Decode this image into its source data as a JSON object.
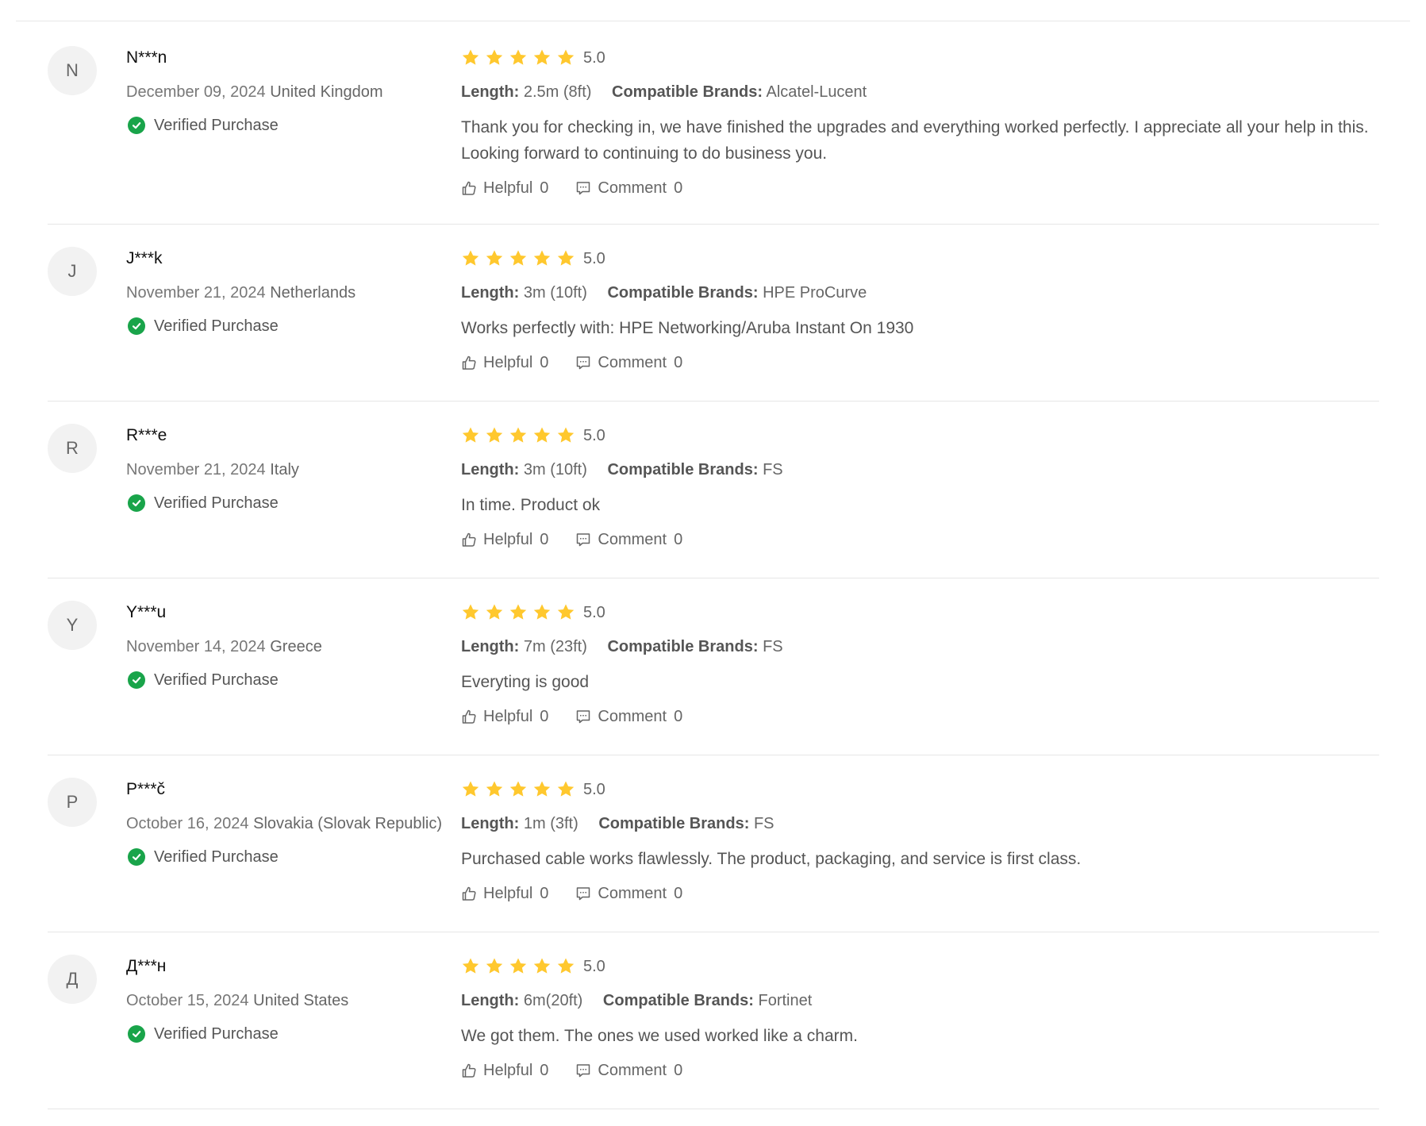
{
  "colors": {
    "star": "#FFC82E",
    "verified": "#19A44A",
    "divider": "#E6E6E6"
  },
  "labels": {
    "verified": "Verified Purchase",
    "length": "Length:",
    "brands": "Compatible Brands:",
    "helpful": "Helpful",
    "comment": "Comment"
  },
  "reviews": [
    {
      "initial": "N",
      "name": "N***n",
      "date": "December 09, 2024",
      "country": "United Kingdom",
      "rating": "5.0",
      "stars": 5,
      "length": "2.5m (8ft)",
      "brands": "Alcatel-Lucent",
      "text": "Thank you for checking in, we have finished the upgrades and everything worked perfectly. I appreciate all your help in this. Looking forward to continuing to do business you.",
      "helpful": "0",
      "comments": "0"
    },
    {
      "initial": "J",
      "name": "J***k",
      "date": "November 21, 2024",
      "country": "Netherlands",
      "rating": "5.0",
      "stars": 5,
      "length": "3m (10ft)",
      "brands": "HPE ProCurve",
      "text": "Works perfectly with: HPE Networking/Aruba Instant On 1930",
      "helpful": "0",
      "comments": "0"
    },
    {
      "initial": "R",
      "name": "R***e",
      "date": "November 21, 2024",
      "country": "Italy",
      "rating": "5.0",
      "stars": 5,
      "length": "3m (10ft)",
      "brands": "FS",
      "text": "In time. Product ok",
      "helpful": "0",
      "comments": "0"
    },
    {
      "initial": "Y",
      "name": "Y***u",
      "date": "November 14, 2024",
      "country": "Greece",
      "rating": "5.0",
      "stars": 5,
      "length": "7m (23ft)",
      "brands": "FS",
      "text": "Everyting is good",
      "helpful": "0",
      "comments": "0"
    },
    {
      "initial": "P",
      "name": "P***č",
      "date": "October 16, 2024",
      "country": "Slovakia (Slovak Republic)",
      "rating": "5.0",
      "stars": 5,
      "length": "1m (3ft)",
      "brands": "FS",
      "text": "Purchased cable works flawlessly. The product, packaging, and service is first class.",
      "helpful": "0",
      "comments": "0"
    },
    {
      "initial": "Д",
      "name": "Д***н",
      "date": "October 15, 2024",
      "country": "United States",
      "rating": "5.0",
      "stars": 5,
      "length": "6m(20ft)",
      "brands": "Fortinet",
      "text": "We got them. The ones we used worked like a charm.",
      "helpful": "0",
      "comments": "0"
    }
  ]
}
